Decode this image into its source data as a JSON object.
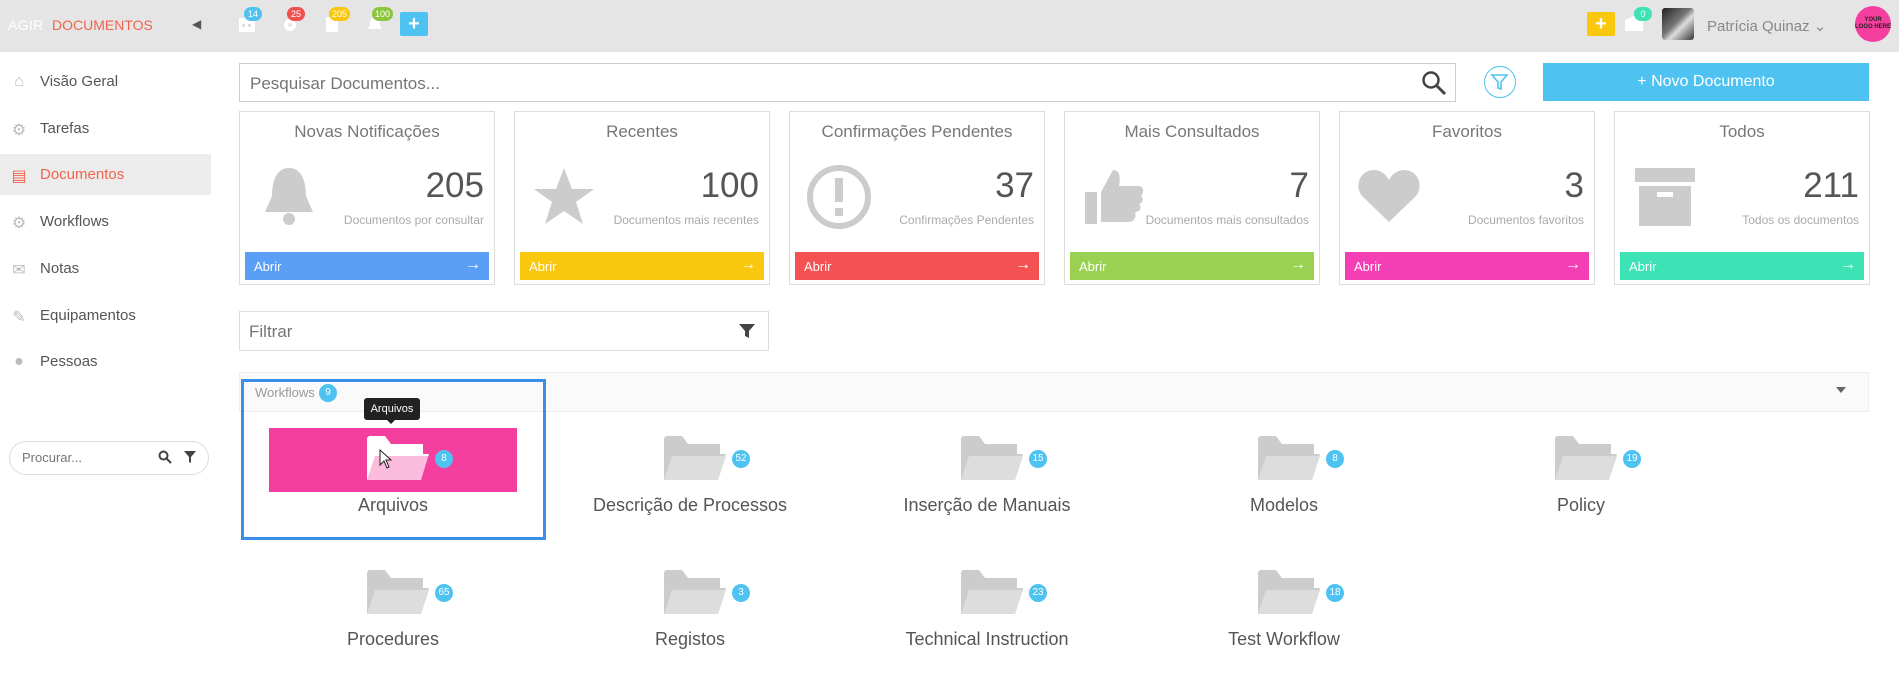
{
  "topbar": {
    "brand_small": "AGIR",
    "brand_main": "DOCUMENTOS",
    "badges": [
      {
        "icon": "calendar-icon",
        "count": "14",
        "color": "#4ec2f0"
      },
      {
        "icon": "gear-icon",
        "count": "25",
        "color": "#f05050"
      },
      {
        "icon": "document-icon",
        "count": "205",
        "color": "#f9c80e"
      },
      {
        "icon": "bell-icon",
        "count": "100",
        "color": "#8cc63f"
      }
    ],
    "message_count": "0",
    "user_name": "Patrícia Quinaz",
    "logo_text": "YOUR LOGO HERE"
  },
  "sidebar": {
    "items": [
      {
        "label": "Visão Geral",
        "icon": "home-icon"
      },
      {
        "label": "Tarefas",
        "icon": "gear-icon"
      },
      {
        "label": "Documentos",
        "icon": "document-icon",
        "active": true
      },
      {
        "label": "Workflows",
        "icon": "gears-icon"
      },
      {
        "label": "Notas",
        "icon": "comments-icon"
      },
      {
        "label": "Equipamentos",
        "icon": "wrench-icon"
      },
      {
        "label": "Pessoas",
        "icon": "user-icon"
      }
    ],
    "search_placeholder": "Procurar..."
  },
  "search": {
    "placeholder": "Pesquisar Documentos..."
  },
  "new_document_label": "+ Novo Documento",
  "cards": [
    {
      "title": "Novas Notificações",
      "count": "205",
      "subtitle": "Documentos por consultar",
      "action": "Abrir",
      "color": "#5b9ef5",
      "icon": "bell-icon"
    },
    {
      "title": "Recentes",
      "count": "100",
      "subtitle": "Documentos mais recentes",
      "action": "Abrir",
      "color": "#f9c80e",
      "icon": "star-icon"
    },
    {
      "title": "Confirmações Pendentes",
      "count": "37",
      "subtitle": "Confirmações Pendentes",
      "action": "Abrir",
      "color": "#f45252",
      "icon": "exclamation-icon"
    },
    {
      "title": "Mais Consultados",
      "count": "7",
      "subtitle": "Documentos mais consultados",
      "action": "Abrir",
      "color": "#9ad153",
      "icon": "thumbs-up-icon"
    },
    {
      "title": "Favoritos",
      "count": "3",
      "subtitle": "Documentos favoritos",
      "action": "Abrir",
      "color": "#f43fb4",
      "icon": "heart-icon"
    },
    {
      "title": "Todos",
      "count": "211",
      "subtitle": "Todos os documentos",
      "action": "Abrir",
      "color": "#3de3b5",
      "icon": "archive-icon"
    }
  ],
  "filter": {
    "placeholder": "Filtrar"
  },
  "workflows": {
    "label": "Workflows",
    "count": "9",
    "tooltip": "Arquivos",
    "folders": [
      {
        "label": "Arquivos",
        "count": "8",
        "highlight": true
      },
      {
        "label": "Descrição de Processos",
        "count": "52"
      },
      {
        "label": "Inserção de Manuais",
        "count": "15"
      },
      {
        "label": "Modelos",
        "count": "8"
      },
      {
        "label": "Policy",
        "count": "19"
      },
      {
        "label": "Procedures",
        "count": "65"
      },
      {
        "label": "Registos",
        "count": "3"
      },
      {
        "label": "Technical Instruction",
        "count": "23"
      },
      {
        "label": "Test Workflow",
        "count": "18"
      }
    ]
  }
}
